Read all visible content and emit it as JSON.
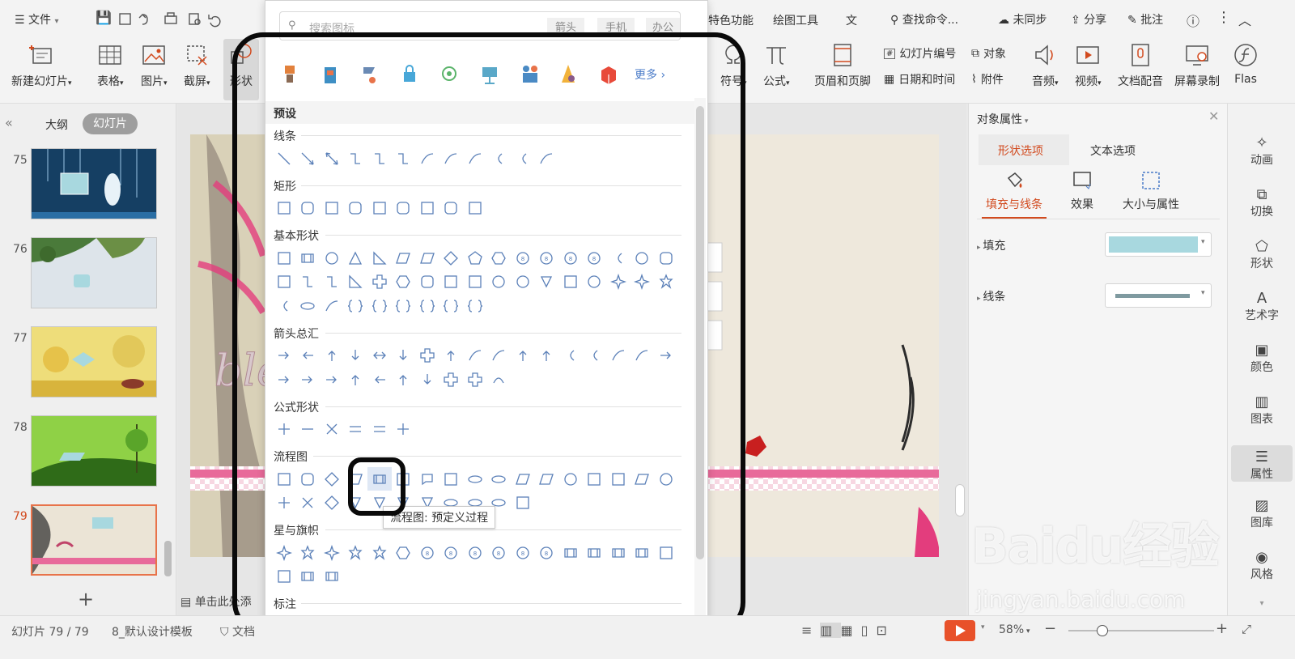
{
  "topbar": {
    "menu_label": "文件",
    "tabs": [
      "特色功能",
      "绘图工具",
      "文"
    ],
    "search_cmd": "查找命令...",
    "sync": "未同步",
    "share": "分享",
    "comment": "批注"
  },
  "ribbon": {
    "new_slide": "新建幻灯片",
    "table": "表格",
    "picture": "图片",
    "screenshot": "截屏",
    "shape": "形状",
    "symbol": "符号",
    "formula": "公式",
    "header_footer": "页眉和页脚",
    "slide_number": "幻灯片编号",
    "object": "对象",
    "date_time": "日期和时间",
    "attachment": "附件",
    "audio": "音频",
    "video": "视频",
    "voiceover": "文档配音",
    "screen_record": "屏幕录制",
    "flash": "Flas"
  },
  "left_pane": {
    "tab_outline": "大纲",
    "tab_slides": "幻灯片",
    "slides": [
      {
        "num": "75",
        "color": "#1c4f7a"
      },
      {
        "num": "76",
        "color": "#d4dce4"
      },
      {
        "num": "77",
        "color": "#e8d469"
      },
      {
        "num": "78",
        "color": "#7fc23a"
      },
      {
        "num": "79",
        "color": "#ece6da"
      }
    ],
    "notes_hint": "单击此处添"
  },
  "shape_popup": {
    "search_placeholder": "搜索图标",
    "search_tags": [
      "箭头",
      "手机",
      "办公"
    ],
    "more": "更多",
    "preset_header": "预设",
    "sections": [
      {
        "title": "线条",
        "rows": [
          12
        ]
      },
      {
        "title": "矩形",
        "rows": [
          9
        ]
      },
      {
        "title": "基本形状",
        "rows": [
          17,
          17,
          9
        ]
      },
      {
        "title": "箭头总汇",
        "rows": [
          17,
          10
        ]
      },
      {
        "title": "公式形状",
        "rows": [
          6
        ]
      },
      {
        "title": "流程图",
        "rows": [
          17,
          11
        ]
      },
      {
        "title": "星与旗帜",
        "rows": [
          17,
          3
        ]
      },
      {
        "title": "标注",
        "rows": []
      }
    ],
    "tooltip": "流程图: 预定义过程",
    "selected_section": "流程图",
    "selected_index": 4
  },
  "right_panel": {
    "title": "对象属性",
    "tab_shape": "形状选项",
    "tab_text": "文本选项",
    "sub_fill_line": "填充与线条",
    "sub_effect": "效果",
    "sub_size": "大小与属性",
    "fill_label": "填充",
    "line_label": "线条",
    "fill_color": "#a8d8df",
    "line_color": "#7f9aa0"
  },
  "right_tools": [
    "动画",
    "切换",
    "形状",
    "艺术字",
    "颜色",
    "图表",
    "属性",
    "图库",
    "风格"
  ],
  "status": {
    "slide_count": "幻灯片 79 / 79",
    "template": "8_默认设计模板",
    "doc": "文档",
    "zoom": "58%"
  },
  "watermark": {
    "brand": "Baidu经验",
    "url": "jingyan.baidu.com"
  },
  "colors": {
    "accent": "#d24a1e",
    "play": "#e8512a",
    "shape_outline": "#5b80b8"
  }
}
